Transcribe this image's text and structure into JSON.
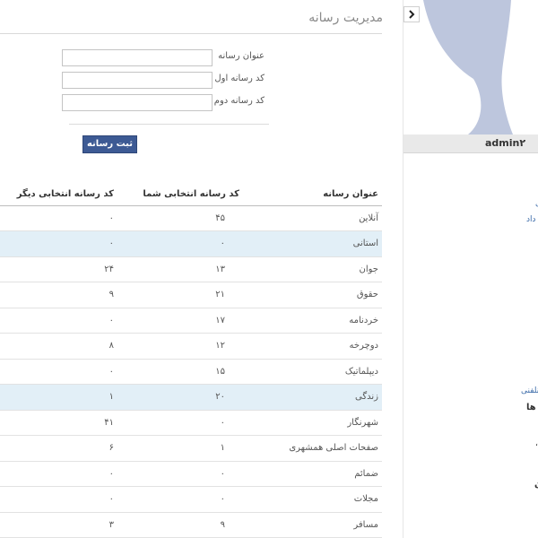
{
  "page": {
    "title": "مدیریت رسانه"
  },
  "form": {
    "media_title_label": "عنوان رسانه",
    "media_title_value": "",
    "first_code_label": "کد رسانه اول",
    "first_code_value": "",
    "second_code_label": "کد رسانه دوم",
    "second_code_value": "",
    "submit_label": "ثبت رسانه"
  },
  "table": {
    "headers": {
      "name": "عنوان رسانه",
      "mine": "کد رسانه انتخابی شما",
      "other": "کد رسانه انتخابی دیگر"
    },
    "rows": [
      {
        "name": "آنلاین",
        "mine": "۴۵",
        "other": "۰",
        "highlighted": false
      },
      {
        "name": "استانی",
        "mine": "۰",
        "other": "۰",
        "highlighted": true
      },
      {
        "name": "جوان",
        "mine": "۱۳",
        "other": "۲۴",
        "highlighted": false
      },
      {
        "name": "حقوق",
        "mine": "۲۱",
        "other": "۹",
        "highlighted": false
      },
      {
        "name": "خردنامه",
        "mine": "۱۷",
        "other": "۰",
        "highlighted": false
      },
      {
        "name": "دوچرخه",
        "mine": "۱۲",
        "other": "۸",
        "highlighted": false
      },
      {
        "name": "دیپلماتیک",
        "mine": "۱۵",
        "other": "۰",
        "highlighted": false
      },
      {
        "name": "زندگی",
        "mine": "۲۰",
        "other": "۱",
        "highlighted": true
      },
      {
        "name": "شهرنگار",
        "mine": "۰",
        "other": "۴۱",
        "highlighted": false
      },
      {
        "name": "صفحات اصلی همشهری",
        "mine": "۱",
        "other": "۶",
        "highlighted": false
      },
      {
        "name": "ضمائم",
        "mine": "۰",
        "other": "۰",
        "highlighted": false
      },
      {
        "name": "مجلات",
        "mine": "۰",
        "other": "۰",
        "highlighted": false
      },
      {
        "name": "مسافر",
        "mine": "۹",
        "other": "۳",
        "highlighted": false
      }
    ]
  },
  "sidebar": {
    "username": "admin۲",
    "toggle_icon": "chevron-right-icon",
    "fragments": [
      "ی",
      "داد",
      "نلفنی",
      "ی ها",
      "،",
      "ن"
    ]
  },
  "colors": {
    "button": "#3d5a94",
    "row_highlight": "#e2eff7",
    "avatar_bg": "#bdc6dd",
    "link": "#3a6aa8"
  }
}
